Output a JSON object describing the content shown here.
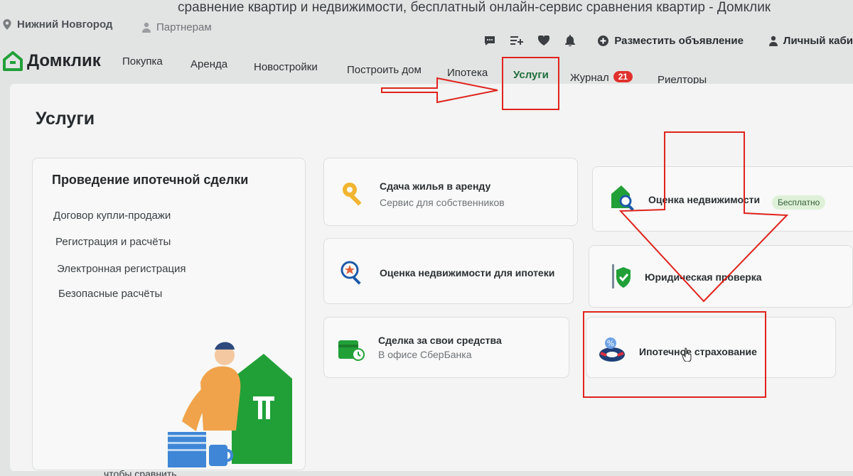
{
  "window": {
    "title": "сравнение квартир и недвижимости, бесплатный онлайн-сервис сравнения квартир - Домклик"
  },
  "topbar": {
    "city": "Нижний Новгород",
    "partners": "Партнерам",
    "post_ad": "Разместить объявление",
    "cabinet": "Личный каби"
  },
  "navbar": {
    "logo": "Домклик",
    "items": [
      {
        "label": "Покупка"
      },
      {
        "label": "Аренда"
      },
      {
        "label": "Новостройки"
      },
      {
        "label": "Построить дом"
      },
      {
        "label": "Ипотека"
      },
      {
        "label": "Услуги",
        "active": true
      },
      {
        "label": "Журнал",
        "badge": "21"
      },
      {
        "label": "Риелторы"
      }
    ]
  },
  "page": {
    "title": "Услуги"
  },
  "left_card": {
    "title": "Проведение ипотечной сделки",
    "links": [
      "Договор купли-продажи",
      "Регистрация и расчёты",
      "Электронная регистрация",
      "Безопасные расчёты"
    ]
  },
  "services": [
    {
      "title": "Сдача жилья в аренду",
      "subtitle": "Сервис для собственников",
      "icon": "key-icon"
    },
    {
      "title": "Оценка недвижимости",
      "tag": "Бесплатно",
      "icon": "house-magnifier-icon"
    },
    {
      "title": "Оценка недвижимости для ипотеки",
      "icon": "magnifier-star-icon"
    },
    {
      "title": "Юридическая проверка",
      "icon": "shield-check-icon"
    },
    {
      "title": "Сделка за свои средства",
      "subtitle": "В офисе СберБанка",
      "icon": "card-clock-icon"
    },
    {
      "title": "Ипотечное страхование",
      "icon": "lifebuoy-percent-icon"
    }
  ],
  "footer": {
    "partial_text": "чтобы сравнить"
  },
  "colors": {
    "brand_green": "#21a038",
    "annotation_red": "#e0231d",
    "badge_red": "#e0312e"
  }
}
